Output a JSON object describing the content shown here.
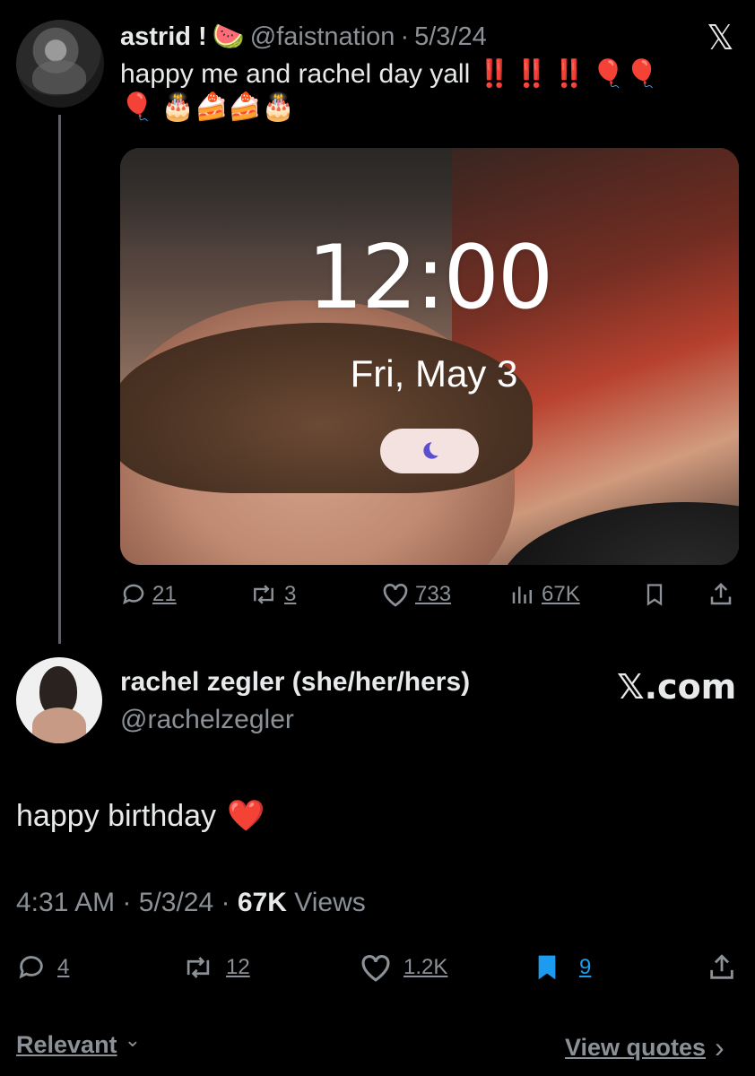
{
  "tweet1": {
    "display_name": "astrid !",
    "name_emoji": "🍉",
    "handle": "@faistnation",
    "separator": "·",
    "date": "5/3/24",
    "text_main": "happy me and rachel day yall",
    "text_bangs": "‼️ ‼️ ‼️",
    "text_emojis_line1": "🎈🎈",
    "text_emojis_line2": "🎈 🎂🍰🍰🎂",
    "media": {
      "time": "12:00",
      "date": "Fri, May 3",
      "moon_icon": "moon-icon"
    },
    "stats": {
      "replies": "21",
      "retweets": "3",
      "likes": "733",
      "views": "67K"
    }
  },
  "tweet2": {
    "display_name": "rachel zegler (she/her/hers)",
    "handle": "@rachelzegler",
    "brand": "𝕏.com",
    "text": "happy birthday",
    "text_emoji": "❤️",
    "time": "4:31 AM",
    "separator": "·",
    "date": "5/3/24",
    "views_count": "67K",
    "views_label": "Views",
    "stats": {
      "replies": "4",
      "retweets": "12",
      "likes": "1.2K",
      "bookmarks": "9"
    }
  },
  "footer": {
    "sort_label": "Relevant",
    "sort_chevron": "⌄",
    "quotes_label": "View quotes",
    "quotes_chevron": "›"
  },
  "colors": {
    "background": "#000000",
    "text": "#e7e9ea",
    "muted": "#8b9196",
    "bookmark_blue": "#1d9bf0",
    "bang_red": "#e0322a"
  },
  "top_x_logo": "𝕏"
}
